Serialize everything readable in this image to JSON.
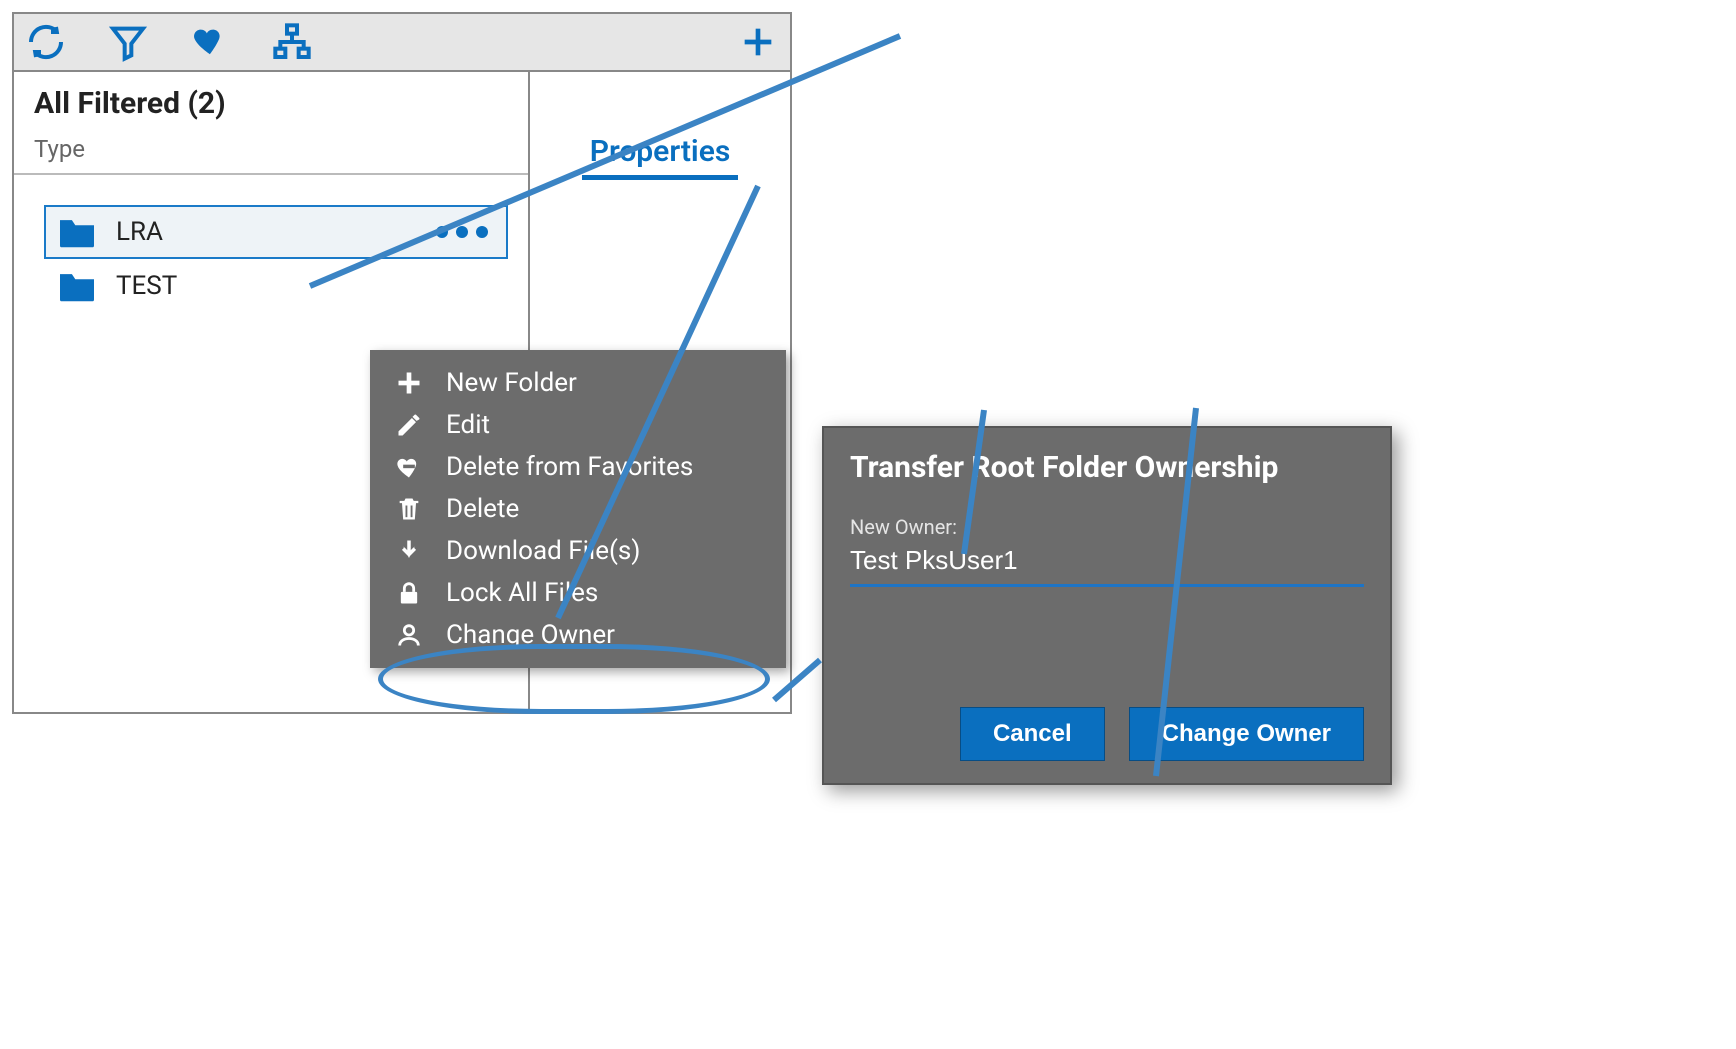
{
  "panel": {
    "title": "All Filtered (2)",
    "type_label": "Type",
    "folders": [
      {
        "name": "LRA",
        "selected": true
      },
      {
        "name": "TEST",
        "selected": false
      }
    ]
  },
  "props_tab_label": "Properties",
  "context_menu": {
    "items": [
      {
        "icon": "plus-icon",
        "label": "New Folder"
      },
      {
        "icon": "pencil-icon",
        "label": "Edit"
      },
      {
        "icon": "heart-remove-icon",
        "label": "Delete from Favorites"
      },
      {
        "icon": "trash-icon",
        "label": "Delete"
      },
      {
        "icon": "download-icon",
        "label": "Download File(s)"
      },
      {
        "icon": "lock-icon",
        "label": "Lock All Files"
      },
      {
        "icon": "person-icon",
        "label": "Change Owner"
      }
    ]
  },
  "dialog": {
    "title": "Transfer Root Folder Ownership",
    "new_owner_label": "New Owner:",
    "new_owner_value": "Test PksUser1",
    "cancel": "Cancel",
    "submit": "Change Owner"
  }
}
